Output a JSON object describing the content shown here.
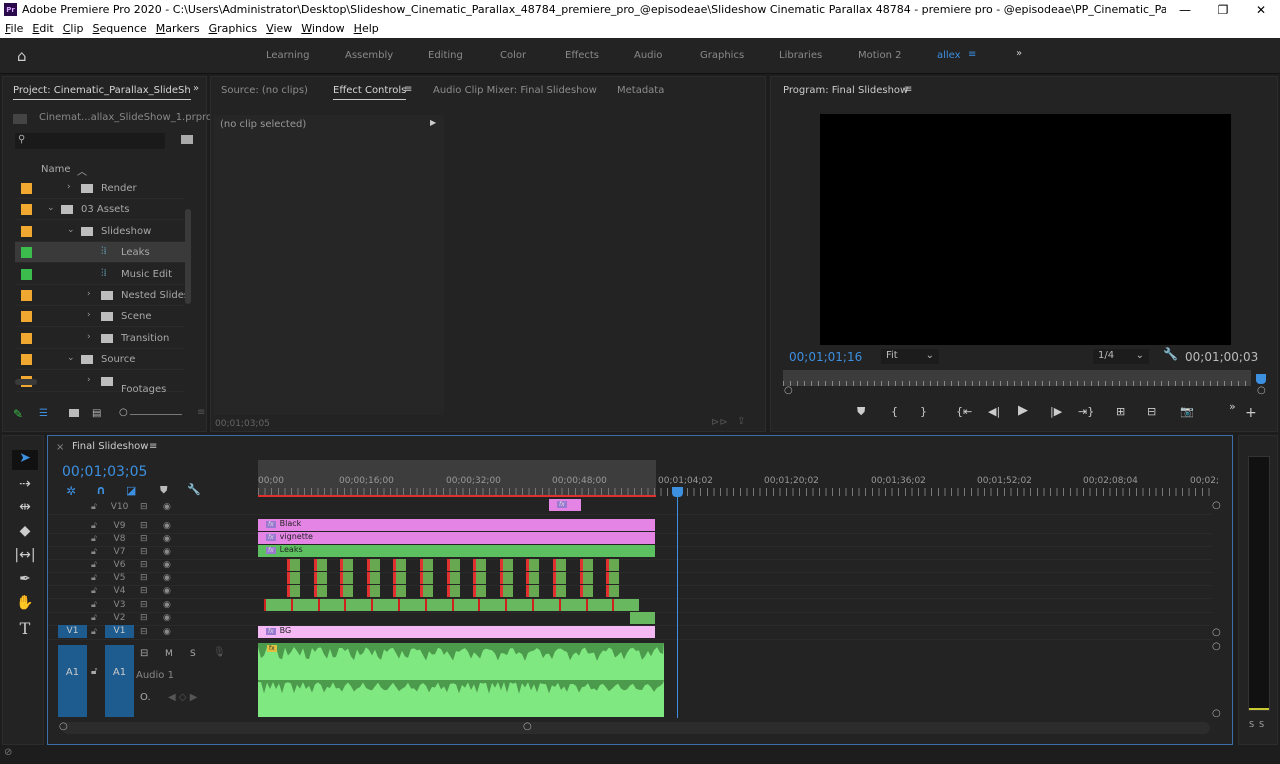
{
  "app": {
    "title": "Adobe Premiere Pro 2020 - C:\\Users\\Administrator\\Desktop\\Slideshow_Cinematic_Parallax_48784_premiere_pro_@episodeae\\Slideshow  Cinematic Parallax 48784 - premiere pro - @episodeae\\PP_Cinematic_ParallaxSlideshow\\Cinematic_Para...",
    "logo": "Pr"
  },
  "menu": [
    "File",
    "Edit",
    "Clip",
    "Sequence",
    "Markers",
    "Graphics",
    "View",
    "Window",
    "Help"
  ],
  "workspaces": [
    "Learning",
    "Assembly",
    "Editing",
    "Color",
    "Effects",
    "Audio",
    "Graphics",
    "Libraries",
    "Motion 2",
    "allex"
  ],
  "project": {
    "tab": "Project: Cinematic_Parallax_SlideSh",
    "file": "Cinemat...allax_SlideShow_1.prproj",
    "search_placeholder": "",
    "name_header": "Name",
    "items": [
      {
        "label": "Render",
        "color": "#f0a830",
        "indent": 1,
        "type": "folder",
        "open": false
      },
      {
        "label": "03 Assets",
        "color": "#f0a830",
        "indent": 0,
        "type": "folder",
        "open": true
      },
      {
        "label": "Slideshow",
        "color": "#f0a830",
        "indent": 1,
        "type": "folder",
        "open": true
      },
      {
        "label": "Leaks",
        "color": "#3cbc4c",
        "indent": 2,
        "type": "sequence",
        "selected": true
      },
      {
        "label": "Music Edit",
        "color": "#3cbc4c",
        "indent": 2,
        "type": "sequence"
      },
      {
        "label": "Nested Slides",
        "color": "#f0a830",
        "indent": 2,
        "type": "folder",
        "open": false
      },
      {
        "label": "Scene",
        "color": "#f0a830",
        "indent": 2,
        "type": "folder",
        "open": false
      },
      {
        "label": "Transition",
        "color": "#f0a830",
        "indent": 2,
        "type": "folder",
        "open": false
      },
      {
        "label": "Source",
        "color": "#f0a830",
        "indent": 1,
        "type": "folder",
        "open": true
      },
      {
        "label": "Footages",
        "color": "#f0a830",
        "indent": 2,
        "type": "folder",
        "open": false
      }
    ]
  },
  "source": {
    "tabs": [
      "Source: (no clips)",
      "Effect Controls",
      "Audio Clip Mixer: Final Slideshow",
      "Metadata"
    ],
    "active": 1,
    "no_clip": "(no clip selected)",
    "timecode": "00;01;03;05"
  },
  "program": {
    "tab": "Program: Final Slideshow",
    "timecode": "00;01;01;16",
    "fit": "Fit",
    "resolution": "1/4",
    "duration": "00;01;00;03"
  },
  "timeline": {
    "tab": "Final Slideshow",
    "timecode": "00;01;03;05",
    "playhead": "00;01;03;05",
    "ruler": [
      "00;00",
      "00;00;16;00",
      "00;00;32;00",
      "00;00;48;00",
      "00;01;04;02",
      "00;01;20;02",
      "00;01;36;02",
      "00;01;52;02",
      "00;02;08;04",
      "00;02;"
    ],
    "video_tracks": [
      "V10",
      "V9",
      "V8",
      "V7",
      "V6",
      "V5",
      "V4",
      "V3",
      "V2",
      "V1"
    ],
    "source_patch": "V1",
    "audio": {
      "track": "A1",
      "source_patch": "A1",
      "name": "Audio 1",
      "mute": "M",
      "solo": "S"
    },
    "clips": {
      "V9": "Black",
      "V8": "vignette",
      "V7": "Leaks",
      "V1": "BG"
    },
    "colors": {
      "pink": "#e484e4",
      "green": "#5cc060",
      "light_pink": "#f4b8f4",
      "audio": "#80e880",
      "playhead": "#3d8fe0"
    }
  },
  "meters": {
    "labels": [
      "S",
      "S"
    ]
  }
}
